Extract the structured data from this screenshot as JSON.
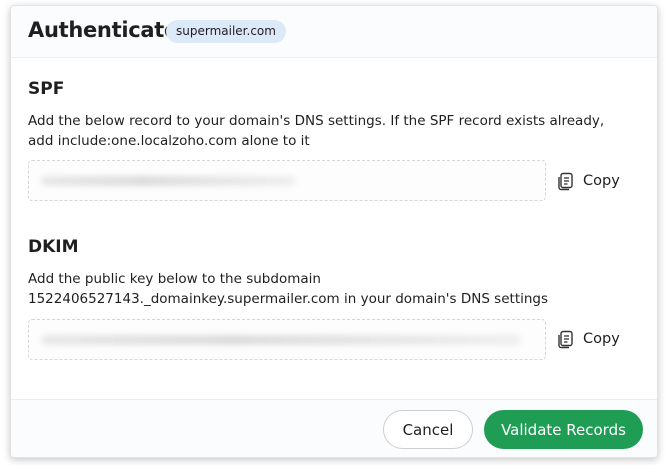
{
  "dialog": {
    "title": "Authenticate",
    "domain": "supermailer.com"
  },
  "spf": {
    "title": "SPF",
    "description": "Add the below record to your domain's DNS settings. If the SPF record exists already, add include:one.localzoho.com alone to it",
    "copy_label": "Copy"
  },
  "dkim": {
    "title": "DKIM",
    "description_line1": "Add the public key below to the subdomain",
    "description_line2": "1522406527143._domainkey.supermailer.com in your domain's DNS settings",
    "copy_label": "Copy"
  },
  "footer": {
    "cancel_label": "Cancel",
    "validate_label": "Validate Records"
  },
  "colors": {
    "primary": "#1f9d55",
    "badge_bg": "#dbe9f8",
    "text": "#1f1f1f"
  },
  "icons": {
    "copy": "copy-icon"
  }
}
